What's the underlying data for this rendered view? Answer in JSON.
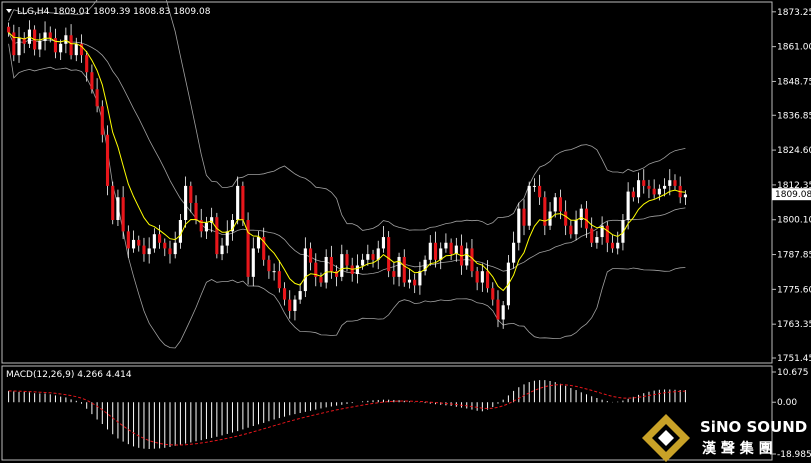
{
  "header": {
    "dropdown_icon": "triangle-down-icon",
    "symbol": "LLG,H4",
    "ohlc": "1809.01 1809.39 1808.83 1809.08"
  },
  "price_axis": {
    "ticks": [
      "1873.25",
      "1861.00",
      "1848.75",
      "1836.85",
      "1824.60",
      "1812.35",
      "1800.10",
      "1787.85",
      "1775.60",
      "1763.35",
      "1751.45"
    ],
    "current_price": "1809.08"
  },
  "macd_panel": {
    "label": "MACD(12,26,9) 4.266 4.414",
    "ticks": [
      "10.675",
      "0.00",
      "-18.985"
    ]
  },
  "logo": {
    "brand_name": "SiNO SOUND",
    "chinese_name": "漢 聲 集 團"
  },
  "colors": {
    "background": "#000000",
    "bull_candle": "#ffffff",
    "bear_candle": "#e8161b",
    "wick": "#ffffff",
    "fast_ma": "#ffff00",
    "bands": "#a0a0a0",
    "macd_histogram": "#ffffff",
    "macd_signal": "#e8161b",
    "axis_line": "#bcbcbc",
    "price_tag_bg": "#ffffff"
  },
  "chart_data": {
    "type": "candlestick",
    "timeframe": "H4",
    "ylim": [
      1751.45,
      1876
    ],
    "y_ticks": [
      1873.25,
      1861.0,
      1848.75,
      1836.85,
      1824.6,
      1812.35,
      1800.1,
      1787.85,
      1775.6,
      1763.35,
      1751.45
    ],
    "closes": [
      1866,
      1858,
      1864,
      1862,
      1867,
      1860,
      1863,
      1866,
      1864,
      1859,
      1862,
      1865,
      1858,
      1862,
      1858,
      1852,
      1846,
      1840,
      1830,
      1812,
      1800,
      1808,
      1796,
      1790,
      1793,
      1791,
      1788,
      1790,
      1795,
      1792,
      1790,
      1788,
      1792,
      1800,
      1812,
      1806,
      1800,
      1796,
      1799,
      1801,
      1788,
      1791,
      1796,
      1800,
      1812,
      1800,
      1780,
      1790,
      1794,
      1786,
      1782,
      1782,
      1776,
      1772,
      1768,
      1772,
      1775,
      1790,
      1785,
      1780,
      1778,
      1787,
      1782,
      1780,
      1788,
      1784,
      1781,
      1784,
      1786,
      1788,
      1786,
      1790,
      1794,
      1782,
      1780,
      1787,
      1778,
      1779,
      1777,
      1782,
      1786,
      1792,
      1786,
      1790,
      1792,
      1788,
      1791,
      1784,
      1790,
      1782,
      1778,
      1782,
      1776,
      1772,
      1765,
      1770,
      1785,
      1792,
      1804,
      1798,
      1812,
      1812,
      1808,
      1798,
      1803,
      1808,
      1803,
      1798,
      1795,
      1800,
      1804,
      1797,
      1792,
      1794,
      1798,
      1792,
      1790,
      1792,
      1800,
      1810,
      1808,
      1814,
      1812,
      1811,
      1809,
      1811,
      1812,
      1814,
      1812,
      1808,
      1809
    ],
    "macd": {
      "label": "MACD(12,26,9)",
      "main": 4.266,
      "signal": 4.414,
      "ylim": [
        -18.985,
        10.675
      ],
      "histogram": [
        4.0,
        3.8,
        3.6,
        3.6,
        3.5,
        3.2,
        3.1,
        3.1,
        2.8,
        2.4,
        2.0,
        1.7,
        1.0,
        0.5,
        -0.5,
        -2.3,
        -4.2,
        -6.1,
        -7.7,
        -9.6,
        -11.3,
        -12.8,
        -13.9,
        -14.8,
        -15.6,
        -16.1,
        -16.4,
        -16.5,
        -16.4,
        -16.3,
        -16.1,
        -15.8,
        -15.4,
        -15.0,
        -14.6,
        -14.2,
        -13.8,
        -13.4,
        -13.0,
        -12.6,
        -12.2,
        -11.7,
        -11.2,
        -10.7,
        -10.2,
        -9.6,
        -9.0,
        -8.4,
        -7.8,
        -7.3,
        -6.7,
        -6.1,
        -5.6,
        -5.1,
        -4.6,
        -4.2,
        -3.8,
        -3.4,
        -3.0,
        -2.6,
        -2.2,
        -1.8,
        -1.5,
        -1.2,
        -0.9,
        -0.6,
        -0.3,
        0.0,
        0.3,
        0.5,
        0.7,
        0.8,
        0.9,
        0.9,
        0.8,
        0.7,
        0.5,
        0.3,
        0.1,
        -0.1,
        -0.3,
        -0.5,
        -0.7,
        -0.9,
        -1.1,
        -1.3,
        -1.6,
        -1.9,
        -2.2,
        -2.6,
        -3.0,
        -3.2,
        -2.6,
        -1.7,
        -0.5,
        0.9,
        2.4,
        4.0,
        5.3,
        6.3,
        7.1,
        7.6,
        7.8,
        7.8,
        7.5,
        7.1,
        6.5,
        5.8,
        5.0,
        4.3,
        3.5,
        2.8,
        2.1,
        1.5,
        0.9,
        0.4,
        0.1,
        0.2,
        0.6,
        1.2,
        1.9,
        2.6,
        3.2,
        3.7,
        4.1,
        4.4,
        4.5,
        4.5,
        4.4,
        4.3,
        4.3
      ]
    }
  }
}
